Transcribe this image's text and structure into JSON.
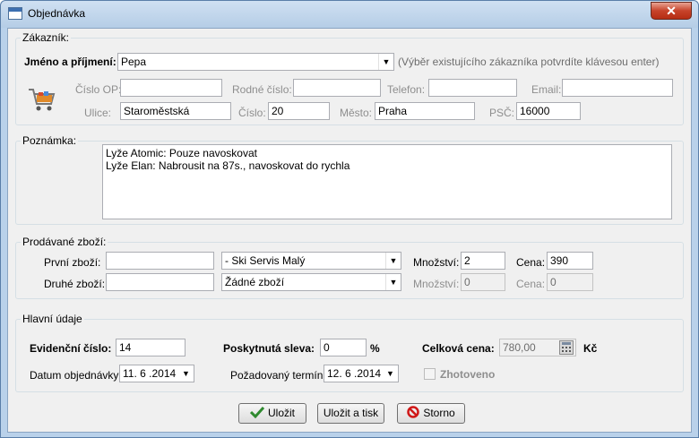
{
  "window": {
    "title": "Objednávka",
    "close_label": "✕"
  },
  "customer": {
    "legend": "Zákazník:",
    "name_label": "Jméno a příjmení:",
    "name_value": "Pepa",
    "hint": "(Výběr existujícího zákazníka potvrdíte klávesou enter)",
    "op_label": "Číslo OP:",
    "op_value": "",
    "birth_label": "Rodné číslo:",
    "birth_value": "",
    "phone_label": "Telefon:",
    "phone_value": "",
    "email_label": "Email:",
    "email_value": "",
    "street_label": "Ulice:",
    "street_value": "Staroměstská",
    "number_label": "Číslo:",
    "number_value": "20",
    "city_label": "Město:",
    "city_value": "Praha",
    "zip_label": "PSČ:",
    "zip_value": "16000"
  },
  "note": {
    "legend": "Poznámka:",
    "line1": "Lyže Atomic: Pouze navoskovat",
    "line2": "Lyže Elan: Nabrousit na 87s., navoskovat do rychla"
  },
  "goods": {
    "legend": "Prodávané zboží:",
    "first_label": "První zboží:",
    "first_code": "",
    "first_item": "- Ski Servis Malý",
    "first_qty_label": "Množství:",
    "first_qty": "2",
    "first_price_label": "Cena:",
    "first_price": "390",
    "second_label": "Druhé zboží:",
    "second_code": "",
    "second_item": "Žádné zboží",
    "second_qty_label": "Množství:",
    "second_qty": "0",
    "second_price_label": "Cena:",
    "second_price": "0"
  },
  "main": {
    "legend": "Hlavní údaje",
    "record_label": "Evidenční číslo:",
    "record_value": "14",
    "discount_label": "Poskytnutá sleva:",
    "discount_value": "0",
    "discount_unit": "%",
    "total_label": "Celková cena:",
    "total_value": "780,00",
    "total_unit": "Kč",
    "order_date_label": "Datum objednávky:",
    "order_date_value": "11. 6 .2014",
    "due_label": "Požadovaný termín:",
    "due_value": "12. 6 .2014",
    "done_label": "Zhotoveno"
  },
  "buttons": {
    "save": "Uložit",
    "save_print": "Uložit a tisk",
    "cancel": "Storno"
  },
  "colors": {
    "accent": "#2f8a2f",
    "cancel": "#d01818",
    "frame": "#b9d1ea"
  },
  "icons": [
    "app-icon",
    "close-icon",
    "shopping-cart-icon",
    "calculator-icon",
    "checkmark-icon",
    "cancel-icon",
    "dropdown-arrow-icon"
  ]
}
